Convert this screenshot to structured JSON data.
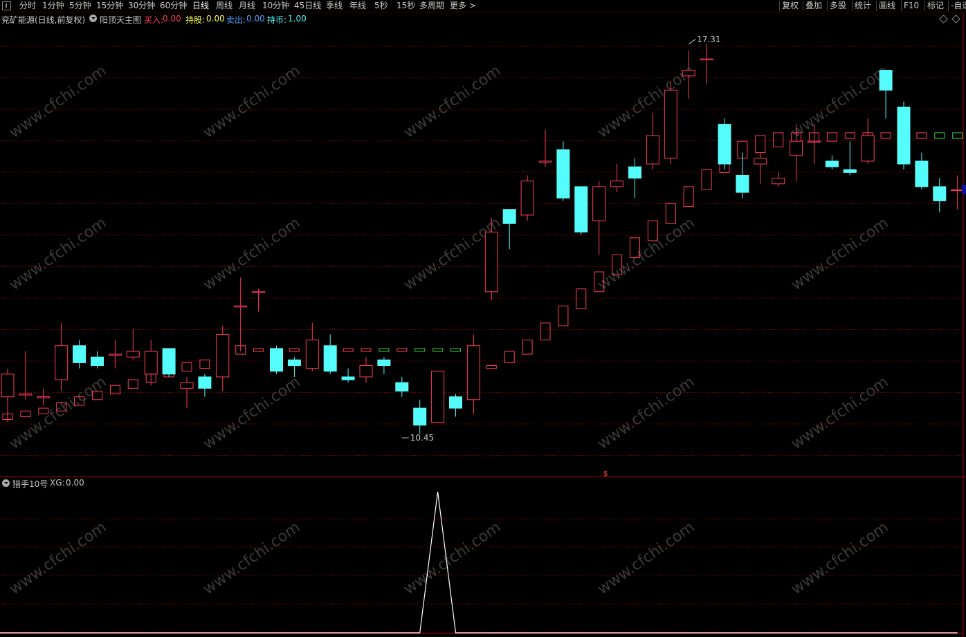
{
  "toolbar": {
    "left_items": [
      "分时",
      "1分钟",
      "5分钟",
      "15分钟",
      "30分钟",
      "60分钟",
      "日线",
      "周线",
      "月线",
      "10分钟",
      "45日线",
      "季线",
      "年线",
      "5秒",
      "15秒",
      "多周期",
      "更多 >"
    ],
    "active": "日线",
    "right_items": [
      "复权",
      "叠加",
      "多股",
      "统计",
      "画线",
      "F10",
      "标记",
      "-自选"
    ]
  },
  "infobar": {
    "stock": "兖矿能源(日线,前复权)",
    "indicator": "阳顶天主图",
    "buy_label": "买入:",
    "buy_value": "0.00",
    "hold_label": "持股:",
    "hold_value": "0.00",
    "sell_label": "卖出:",
    "sell_value": "0.00",
    "coin_label": "持币:",
    "coin_value": "1.00"
  },
  "subpanel": {
    "name": "猎手10号",
    "xg_label": "XG:",
    "xg_value": "0.00"
  },
  "watermark": "www.cfchi.com",
  "colors": {
    "up": "#ff3c5a",
    "down": "#54fcfc",
    "grid": "#8b0000",
    "signal_green": "#3cc83c",
    "buy": "#ff3c5a",
    "hold": "#ffff54",
    "sell": "#54a0ff",
    "coin": "#54fcfc"
  },
  "chart_data": {
    "type": "candlestick",
    "price_axis": {
      "min": 10.0,
      "max": 17.6
    },
    "annotations": [
      {
        "text": "17.31",
        "index": 38,
        "price": 17.31
      },
      {
        "text": "10.45",
        "index": 22,
        "price": 10.45
      }
    ],
    "marker_text": "$",
    "marker_index": 33,
    "candles": [
      [
        11.1,
        11.5,
        11.6,
        10.65
      ],
      [
        11.15,
        11.15,
        11.9,
        11.05
      ],
      [
        11.1,
        11.1,
        11.25,
        10.95
      ],
      [
        11.4,
        12.0,
        12.4,
        11.2
      ],
      [
        12.0,
        11.7,
        12.1,
        11.6
      ],
      [
        11.8,
        11.65,
        11.9,
        11.6
      ],
      [
        11.85,
        11.85,
        12.1,
        11.6
      ],
      [
        11.8,
        11.9,
        12.3,
        11.75
      ],
      [
        11.5,
        11.9,
        12.1,
        11.3
      ],
      [
        11.95,
        11.5,
        11.95,
        11.45
      ],
      [
        11.25,
        11.35,
        11.45,
        10.9
      ],
      [
        11.45,
        11.25,
        11.5,
        11.1
      ],
      [
        11.45,
        12.2,
        12.35,
        11.2
      ],
      [
        12.7,
        12.7,
        13.2,
        11.9
      ],
      [
        12.95,
        12.95,
        13.0,
        12.6
      ],
      [
        11.95,
        11.55,
        12.0,
        11.5
      ],
      [
        11.75,
        11.65,
        11.8,
        11.45
      ],
      [
        11.6,
        12.1,
        12.4,
        11.55
      ],
      [
        12.0,
        11.55,
        12.2,
        11.5
      ],
      [
        11.45,
        11.4,
        11.6,
        11.35
      ],
      [
        11.45,
        11.65,
        11.8,
        11.35
      ],
      [
        11.75,
        11.65,
        11.8,
        11.5
      ],
      [
        11.35,
        11.2,
        11.45,
        11.1
      ],
      [
        10.9,
        10.6,
        11.05,
        10.45
      ],
      [
        10.65,
        11.55,
        11.55,
        10.65
      ],
      [
        11.1,
        10.9,
        11.15,
        10.75
      ],
      [
        11.05,
        12.0,
        12.2,
        10.8
      ],
      [
        12.95,
        14.0,
        14.25,
        12.8
      ],
      [
        14.4,
        14.15,
        14.4,
        13.7
      ],
      [
        14.3,
        14.9,
        15.0,
        14.2
      ],
      [
        15.25,
        15.25,
        15.8,
        15.15
      ],
      [
        15.45,
        14.6,
        15.6,
        14.55
      ],
      [
        14.8,
        14.0,
        14.8,
        13.95
      ],
      [
        14.2,
        14.8,
        14.9,
        13.6
      ],
      [
        14.8,
        14.9,
        15.2,
        14.7
      ],
      [
        15.15,
        14.95,
        15.3,
        14.6
      ],
      [
        15.2,
        15.7,
        16.1,
        15.1
      ],
      [
        15.3,
        16.5,
        16.65,
        15.2
      ],
      [
        16.75,
        16.85,
        17.2,
        16.35
      ],
      [
        17.05,
        17.05,
        17.31,
        16.6
      ],
      [
        15.9,
        15.2,
        16.0,
        15.1
      ],
      [
        15.0,
        14.7,
        15.4,
        14.6
      ],
      [
        15.2,
        15.3,
        15.4,
        14.85
      ],
      [
        14.85,
        14.95,
        15.05,
        14.8
      ],
      [
        15.35,
        15.6,
        15.9,
        14.9
      ],
      [
        15.6,
        15.6,
        15.9,
        15.2
      ],
      [
        15.25,
        15.15,
        15.35,
        15.1
      ],
      [
        15.1,
        15.05,
        15.6,
        15.0
      ],
      [
        15.25,
        15.7,
        16.0,
        15.2
      ],
      [
        16.85,
        16.5,
        16.85,
        16.0
      ],
      [
        16.2,
        15.2,
        16.3,
        15.1
      ],
      [
        15.25,
        14.8,
        15.4,
        14.75
      ],
      [
        14.8,
        14.55,
        14.95,
        14.35
      ],
      [
        14.75,
        14.75,
        15.0,
        14.4
      ]
    ],
    "signal_boxes": [
      [
        10.7,
        10.8
      ],
      [
        10.75,
        10.85
      ],
      [
        10.8,
        10.9
      ],
      [
        10.85,
        11.0
      ],
      [
        10.95,
        11.1
      ],
      [
        11.05,
        11.2
      ],
      [
        11.15,
        11.3
      ],
      [
        11.25,
        11.4
      ],
      [
        11.35,
        11.5
      ],
      [
        11.45,
        11.6
      ],
      [
        11.55,
        11.7
      ],
      [
        11.6,
        11.75
      ],
      [
        11.7,
        11.85
      ],
      [
        11.85,
        12.0
      ],
      [
        11.9,
        11.95
      ],
      [
        11.9,
        11.95
      ],
      [
        11.9,
        11.95
      ],
      [
        11.9,
        11.95
      ],
      [
        11.9,
        11.95
      ],
      [
        11.9,
        11.95
      ],
      [
        11.9,
        11.95
      ],
      [
        11.9,
        11.95
      ],
      [
        11.9,
        11.95
      ],
      [
        11.9,
        11.95
      ],
      [
        11.9,
        11.95
      ],
      [
        11.9,
        11.95
      ],
      [
        11.9,
        11.95
      ],
      [
        11.6,
        11.65
      ],
      [
        11.7,
        11.9
      ],
      [
        11.85,
        12.1
      ],
      [
        12.1,
        12.4
      ],
      [
        12.35,
        12.7
      ],
      [
        12.65,
        13.0
      ],
      [
        12.95,
        13.3
      ],
      [
        13.25,
        13.6
      ],
      [
        13.55,
        13.9
      ],
      [
        13.85,
        14.2
      ],
      [
        14.15,
        14.5
      ],
      [
        14.45,
        14.8
      ],
      [
        14.75,
        15.1
      ],
      [
        15.05,
        15.4
      ],
      [
        15.3,
        15.6
      ],
      [
        15.4,
        15.7
      ],
      [
        15.5,
        15.75
      ],
      [
        15.55,
        15.75
      ],
      [
        15.6,
        15.75
      ],
      [
        15.6,
        15.75
      ],
      [
        15.65,
        15.75
      ],
      [
        15.65,
        15.75
      ],
      [
        15.65,
        15.75
      ],
      [
        15.65,
        15.75
      ],
      [
        15.65,
        15.75
      ],
      [
        15.65,
        15.75
      ],
      [
        15.65,
        15.75
      ]
    ],
    "signal_types": [
      "up",
      "up",
      "up",
      "up",
      "up",
      "up",
      "up",
      "up",
      "up",
      "up",
      "up",
      "up",
      "up",
      "up",
      "up",
      "up",
      "up",
      "up",
      "up",
      "up",
      "up",
      "green",
      "up",
      "green",
      "green",
      "green",
      "green",
      "up",
      "up",
      "up",
      "up",
      "up",
      "up",
      "up",
      "up",
      "up",
      "up",
      "up",
      "up",
      "up",
      "up",
      "up",
      "up",
      "up",
      "up",
      "up",
      "up",
      "up",
      "up",
      "up",
      "up",
      "up",
      "green",
      "green"
    ],
    "sub_xg": [
      0,
      0,
      0,
      0,
      0,
      0,
      0,
      0,
      0,
      0,
      0,
      0,
      0,
      0,
      0,
      0,
      0,
      0,
      0,
      0,
      0,
      0,
      0,
      0,
      1,
      0,
      0,
      0,
      0,
      0,
      0,
      0,
      0,
      0,
      0,
      0,
      0,
      0,
      0,
      0,
      0,
      0,
      0,
      0,
      0,
      0,
      0,
      0,
      0,
      0,
      0,
      0,
      0,
      0
    ],
    "sub_range": [
      0,
      1
    ]
  }
}
